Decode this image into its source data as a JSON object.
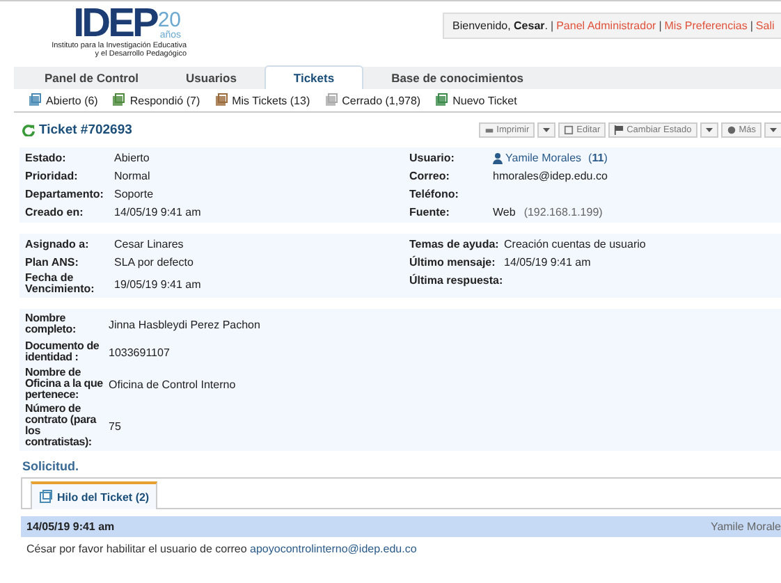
{
  "header": {
    "logo": {
      "name": "IDEP",
      "years": "20",
      "years_word": "años",
      "subtitle": [
        "Instituto para la Investigación Educativa",
        "y el Desarrollo Pedagógico"
      ]
    },
    "welcome": {
      "greeting": "Bienvenido, **Cesar**.",
      "separator": "|",
      "links": [
        "Panel Administrador",
        "Mis Preferencias",
        "Sali"
      ]
    }
  },
  "nav_tabs": [
    {
      "label": "Panel de Control",
      "selected": false
    },
    {
      "label": "Usuarios",
      "selected": false
    },
    {
      "label": "Tickets",
      "selected": true
    },
    {
      "label": "Base de conocimientos",
      "selected": false
    }
  ],
  "sub_nav": [
    {
      "label": "Abierto (6)",
      "kind": "open"
    },
    {
      "label": "Respondió (7)",
      "kind": "answered"
    },
    {
      "label": "Mis Tickets (13)",
      "kind": "mine"
    },
    {
      "label": "Cerrado (1,978)",
      "kind": "closed"
    },
    {
      "label": "Nuevo Ticket",
      "kind": "new"
    }
  ],
  "ticket": {
    "title": "Ticket #702693",
    "actions": [
      {
        "label": "Imprimir",
        "kind": "print",
        "caret": true
      },
      {
        "label": "Editar",
        "kind": "edit",
        "caret": false
      },
      {
        "label": "Cambiar Estado",
        "kind": "flag",
        "caret": true
      },
      {
        "label": "Más",
        "kind": "gear",
        "caret": true
      }
    ]
  },
  "sections": [
    {
      "left": [
        {
          "label": "Estado:",
          "value": "Abierto"
        },
        {
          "label": "Prioridad:",
          "value": "Normal"
        },
        {
          "label": "Departamento:",
          "value": "Soporte"
        },
        {
          "label": "Creado en:",
          "value": "14/05/19 9:41 am"
        }
      ],
      "right": [
        {
          "label": "Usuario:",
          "value": "Yamile Morales",
          "kind": "user",
          "extra": "(**11**)"
        },
        {
          "label": "Correo:",
          "value": "hmorales@idep.edu.co"
        },
        {
          "label": "Teléfono:"
        },
        {
          "label": "Fuente:",
          "value": "Web",
          "kind": "source",
          "extra": "(192.168.1.199)"
        }
      ]
    },
    {
      "left": [
        {
          "label": "Asignado a:",
          "value": "Cesar Linares"
        },
        {
          "label": "Plan ANS:",
          "value": "SLA por defecto"
        },
        {
          "label": "Fecha de Vencimiento:",
          "value": "19/05/19 9:41 am"
        }
      ],
      "right": [
        {
          "label": "Temas de ayuda:",
          "value": "Creación cuentas de usuario"
        },
        {
          "label": "Último mensaje:",
          "value": "14/05/19 9:41 am"
        },
        {
          "label": "Última respuesta:"
        }
      ]
    },
    {
      "left": [
        {
          "label": "Nombre completo:",
          "value": "Jinna Hasbleydi Perez Pachon"
        },
        {
          "label": "Documento de identidad :",
          "value": "1033691107"
        },
        {
          "label": "Nombre de Oficina a la que pertenece:",
          "value": "Oficina de Control Interno"
        },
        {
          "label": "Número de contrato (para los contratistas):",
          "value": "75"
        }
      ]
    }
  ],
  "request_title": "Solicitud.",
  "thread_tabs": [
    {
      "label": "Hilo del Ticket (2)",
      "selected": true
    }
  ],
  "entry": {
    "date": "14/05/19 9:41 am",
    "author": "Yamile Morale",
    "body": "César por favor habilitar el usuario de correo ",
    "link": "apoyocontrolinterno@idep.edu.co"
  }
}
